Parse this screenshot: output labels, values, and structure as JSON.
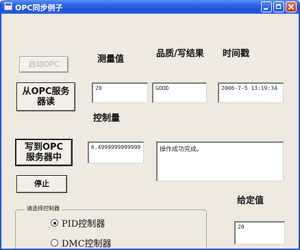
{
  "window": {
    "title": "OPC同步例子"
  },
  "buttons": {
    "start_opc": "启动OPC",
    "read_from_server": "从OPC服务器读",
    "write_to_server": "写到OPC服务器中",
    "stop": "停止"
  },
  "labels": {
    "measured_value": "测量值",
    "quality_write_result": "品质/写结果",
    "timestamp": "时间戳",
    "control_quantity": "控制量",
    "setpoint": "给定值"
  },
  "fields": {
    "measured_value": "20",
    "quality": "GOOD",
    "timestamp": "2006-7-5 13:19:34",
    "control_quantity": "6.4999999999999",
    "write_result": "操作成功完成。",
    "setpoint": "20"
  },
  "controller_group": {
    "title": "请选择控制器",
    "options": [
      "PID控制器",
      "DMC控制器"
    ],
    "selected": "PID控制器"
  }
}
